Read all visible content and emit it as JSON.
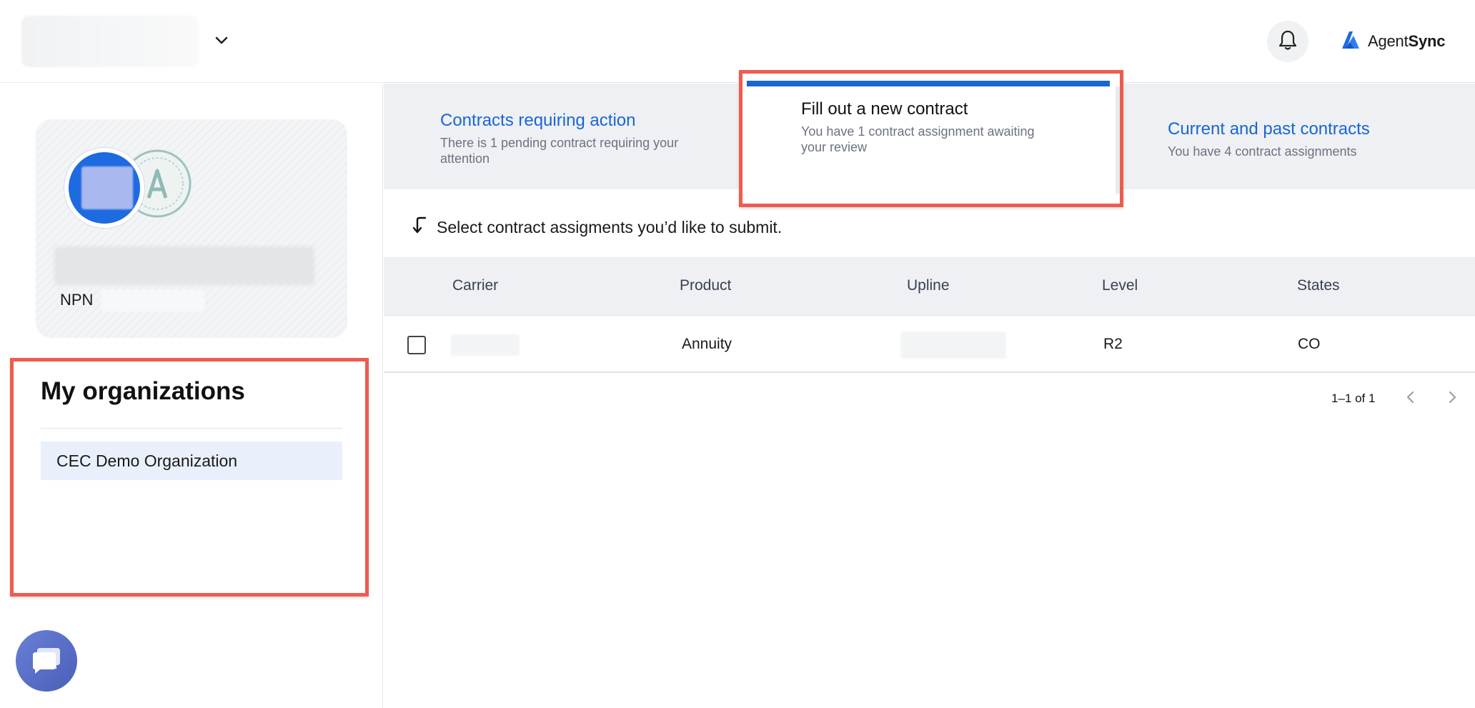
{
  "header": {
    "org_switcher_icon": "chevron-down-icon",
    "notifications_icon": "bell-icon",
    "logo": {
      "word_regular": "Agent",
      "word_bold": "Sync",
      "brand_color": "#1e6ae0"
    }
  },
  "sidebar": {
    "profile": {
      "npn_label": "NPN"
    },
    "organizations": {
      "title": "My organizations",
      "items": [
        {
          "label": "CEC Demo Organization"
        }
      ]
    },
    "chat_icon": "chat-bubble-icon"
  },
  "tabs": [
    {
      "title": "Contracts requiring action",
      "subtitle": "There is 1 pending contract requiring your attention"
    },
    {
      "title": "Fill out a new contract",
      "subtitle": "You have 1 contract assignment awaiting your review",
      "active": true
    },
    {
      "title": "Current and past contracts",
      "subtitle": "You have 4 contract assignments"
    }
  ],
  "main": {
    "instruction": "Select contract assigments you’d like to submit.",
    "table": {
      "headers": [
        "Carrier",
        "Product",
        "Upline",
        "Level",
        "States"
      ],
      "rows": [
        {
          "carrier": "",
          "product": "Annuity",
          "upline": "",
          "level": "R2",
          "states": "CO",
          "checked": false
        }
      ]
    },
    "pagination": {
      "range": "1–1 of 1"
    }
  },
  "colors": {
    "accent": "#1966d2",
    "highlight_border": "#ee5c50",
    "org_item_bg": "#eaf0fb"
  }
}
